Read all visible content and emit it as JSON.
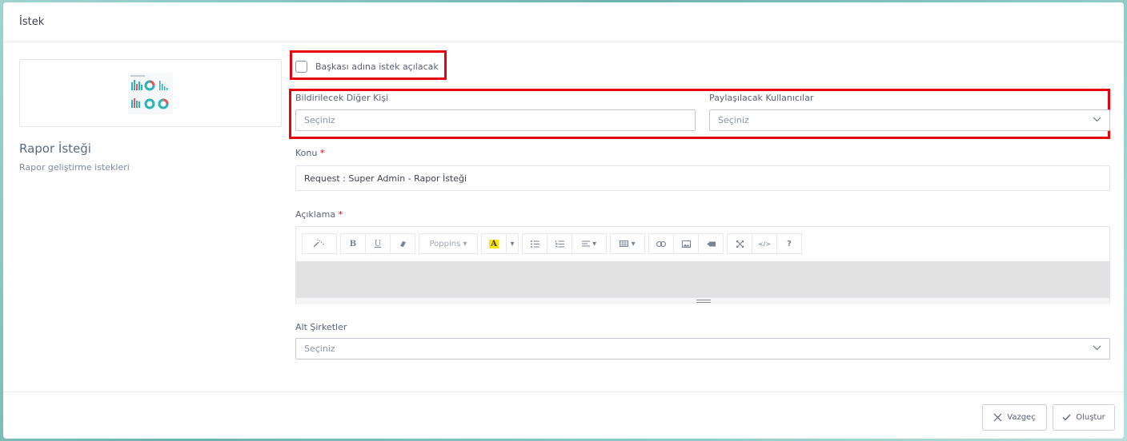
{
  "modal": {
    "title": "İstek"
  },
  "left": {
    "title": "Rapor İsteği",
    "subtitle": "Rapor geliştirme istekleri"
  },
  "form": {
    "on_behalf_label": "Başkası adına istek açılacak",
    "notify_label": "Bildirilecek Diğer Kişi",
    "notify_placeholder": "Seçiniz",
    "share_label": "Paylaşılacak Kullanıcılar",
    "share_placeholder": "Seçiniz",
    "subject_label": "Konu",
    "subject_value": "Request : Super  Admin - Rapor İsteği",
    "description_label": "Açıklama",
    "subsidiaries_label": "Alt Şirketler",
    "subsidiaries_placeholder": "Seçiniz",
    "required_mark": "*"
  },
  "toolbar": {
    "font_name": "Poppins",
    "bold": "B",
    "underline": "U",
    "highlight": "A",
    "help": "?",
    "code": "</>"
  },
  "footer": {
    "cancel_label": "Vazgeç",
    "create_label": "Oluştur"
  },
  "colors": {
    "accent_highlight": "#e8000b",
    "thumb_teal": "#2bb3b8",
    "thumb_red": "#e05a5a"
  }
}
